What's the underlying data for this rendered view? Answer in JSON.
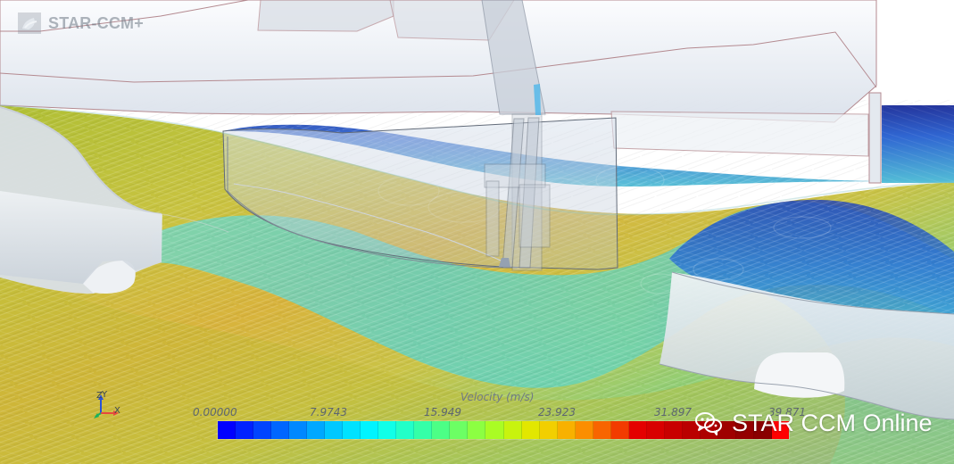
{
  "app": {
    "logo_text": "STAR-CCM+"
  },
  "axes": {
    "x_label": "X",
    "y_label": "Y",
    "z_label": "Z"
  },
  "legend": {
    "title": "Velocity (m/s)",
    "ticks": [
      "0.00000",
      "7.9743",
      "15.949",
      "23.923",
      "31.897",
      "39.871"
    ],
    "colors": [
      "#0000ff",
      "#0022ff",
      "#0044ff",
      "#0066ff",
      "#0088ff",
      "#00a8ff",
      "#00c8ff",
      "#00e2ff",
      "#00f4ff",
      "#10ffe8",
      "#22ffc8",
      "#34ffa8",
      "#4cff86",
      "#6cff64",
      "#8cff42",
      "#aafc24",
      "#c8f30e",
      "#e2e700",
      "#f2cf00",
      "#f8b100",
      "#fb8e00",
      "#f86500",
      "#f23b00",
      "#e40000",
      "#d80000",
      "#c80000",
      "#ba0000",
      "#ad0000",
      "#9f0000",
      "#940000",
      "#8a0000",
      "#ff0000"
    ]
  },
  "watermark": {
    "icon": "wechat-icon",
    "text": "STAR CCM Online"
  },
  "colors": {
    "logo": "#6f7a86",
    "legend_text": "#5d6670",
    "watermark_text": "#ffffff"
  }
}
